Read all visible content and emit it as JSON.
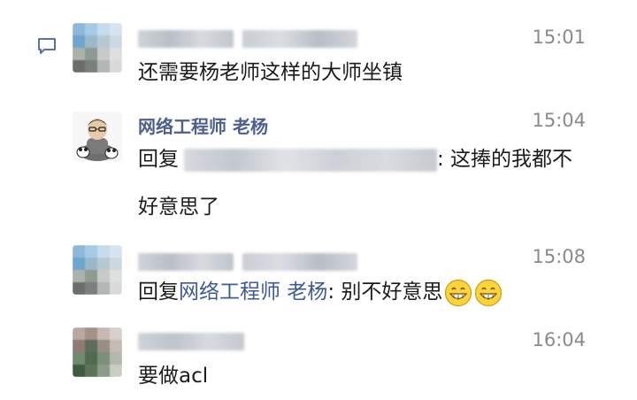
{
  "messages": [
    {
      "time": "15:01",
      "text": "还需要杨老师这样的大师坐镇"
    },
    {
      "sender": "网络工程师 老杨",
      "time": "15:04",
      "reply_prefix": "回复",
      "text_line1": ": 这捧的我都不",
      "text_line2": "好意思了"
    },
    {
      "time": "15:08",
      "reply_prefix": "回复",
      "reply_target": "网络工程师 老杨",
      "text": ": 别不好意思",
      "emoji": [
        "grin-emoji",
        "grin-emoji"
      ]
    },
    {
      "time": "16:04",
      "text": "要做acl"
    }
  ],
  "colors": {
    "sender_name": "#4c5f8f",
    "time": "#8a8a8a",
    "reply_icon": "#5a72a8"
  }
}
